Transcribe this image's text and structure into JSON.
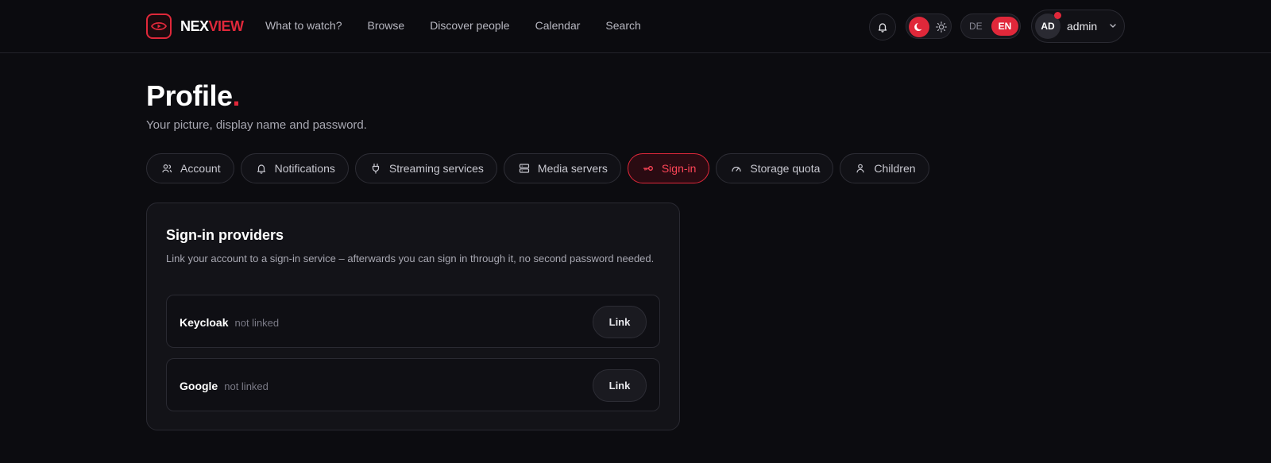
{
  "brand": {
    "part1": "NEX",
    "part2": "VIEW"
  },
  "nav": [
    {
      "label": "What to watch?"
    },
    {
      "label": "Browse"
    },
    {
      "label": "Discover people"
    },
    {
      "label": "Calendar"
    },
    {
      "label": "Search"
    }
  ],
  "header": {
    "bell_icon": "bell-icon",
    "theme": {
      "active": "dark",
      "moon_icon": "moon-icon",
      "sun_icon": "sun-icon"
    },
    "language": {
      "options": [
        "DE",
        "EN"
      ],
      "selected": "EN"
    },
    "user": {
      "initials": "AD",
      "name": "admin",
      "has_notification": true
    }
  },
  "page": {
    "title": "Profile",
    "title_dot": ".",
    "subtitle": "Your picture, display name and password."
  },
  "tabs": [
    {
      "label": "Account",
      "icon": "users-icon",
      "active": false
    },
    {
      "label": "Notifications",
      "icon": "bell-icon",
      "active": false
    },
    {
      "label": "Streaming services",
      "icon": "plug-icon",
      "active": false
    },
    {
      "label": "Media servers",
      "icon": "server-icon",
      "active": false
    },
    {
      "label": "Sign-in",
      "icon": "key-icon",
      "active": true
    },
    {
      "label": "Storage quota",
      "icon": "gauge-icon",
      "active": false
    },
    {
      "label": "Children",
      "icon": "user-icon",
      "active": false
    }
  ],
  "card": {
    "title": "Sign-in providers",
    "description": "Link your account to a sign-in service – afterwards you can sign in through it, no second password needed.",
    "providers": [
      {
        "name": "Keycloak",
        "status": "not linked",
        "action": "Link"
      },
      {
        "name": "Google",
        "status": "not linked",
        "action": "Link"
      }
    ]
  },
  "colors": {
    "accent": "#e0283a",
    "background": "#0c0c10",
    "card": "#131318"
  }
}
